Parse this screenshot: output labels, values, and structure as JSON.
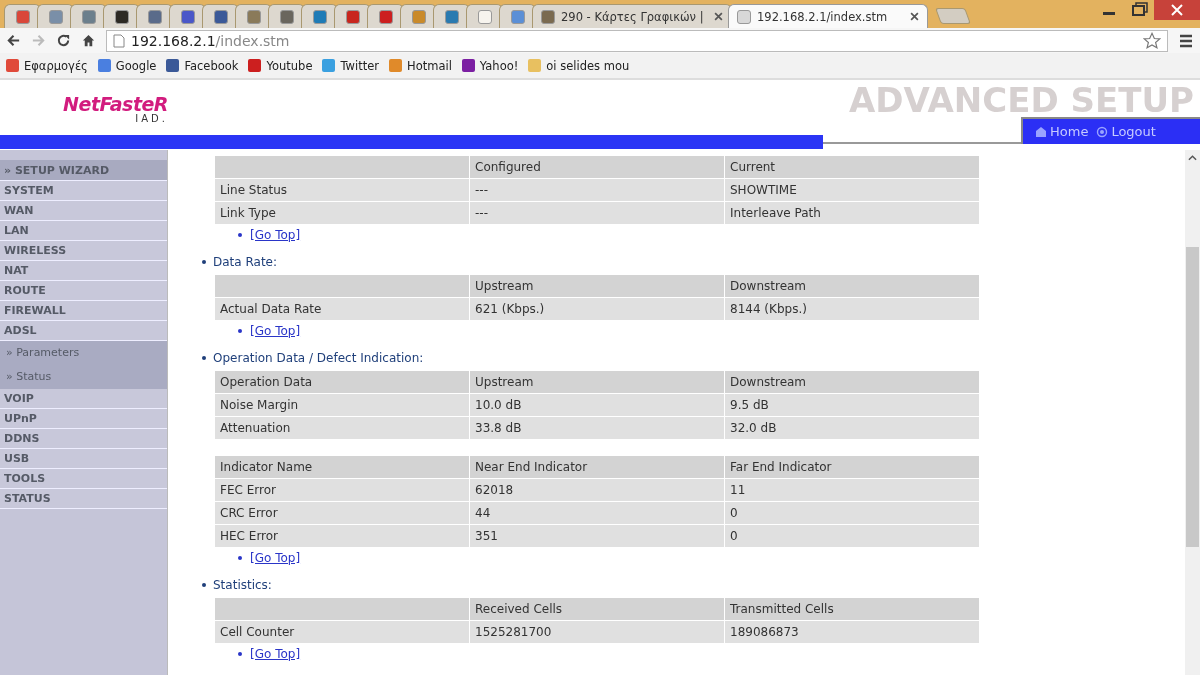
{
  "browser": {
    "tabs": [
      {
        "kind": "favicon",
        "color": "#d9473a",
        "selected": false
      },
      {
        "kind": "favicon",
        "color": "#7a8fa8",
        "selected": false
      },
      {
        "kind": "favicon",
        "color": "#6c7f8c",
        "selected": false
      },
      {
        "kind": "favicon",
        "color": "#2d2a24",
        "selected": false
      },
      {
        "kind": "favicon",
        "color": "#5a6b8a",
        "selected": false
      },
      {
        "kind": "favicon",
        "color": "#4a57c8",
        "selected": false
      },
      {
        "kind": "favicon",
        "color": "#3b5998",
        "selected": false
      },
      {
        "kind": "favicon",
        "color": "#8a7a5a",
        "selected": false
      },
      {
        "kind": "favicon",
        "color": "#6a665e",
        "selected": false
      },
      {
        "kind": "favicon",
        "color": "#1f7bb6",
        "selected": false
      },
      {
        "kind": "favicon",
        "color": "#c8261e",
        "selected": false
      },
      {
        "kind": "favicon",
        "color": "#cc1f1f",
        "selected": false
      },
      {
        "kind": "favicon",
        "color": "#c98a2a",
        "selected": false
      },
      {
        "kind": "favicon",
        "color": "#2a7ab0",
        "selected": false
      },
      {
        "kind": "favicon",
        "color": "#f7f4ee",
        "selected": false
      },
      {
        "kind": "favicon",
        "color": "#5b8fd6",
        "selected": false
      },
      {
        "kind": "titled",
        "title": "290 - Κάρτες Γραφικών |",
        "color": "#7a6a50",
        "selected": false
      },
      {
        "kind": "titled",
        "title": "192.168.2.1/index.stm",
        "color": "#d8d8d8",
        "selected": true
      }
    ],
    "address": {
      "host": "192.168.2.1",
      "path": "/index.stm"
    },
    "bookmarks": [
      {
        "label": "Εφαρμογές",
        "color": "#e04a3a"
      },
      {
        "label": "Google",
        "color": "#4a7fe0"
      },
      {
        "label": "Facebook",
        "color": "#3b5998"
      },
      {
        "label": "Youtube",
        "color": "#cc1f1f"
      },
      {
        "label": "Twitter",
        "color": "#3aa0e0"
      },
      {
        "label": "Hotmail",
        "color": "#e08a2a"
      },
      {
        "label": "Yahoo!",
        "color": "#7b1fa2"
      },
      {
        "label": "oi selides mou",
        "color": "#e8c060"
      }
    ]
  },
  "header": {
    "logo": "NetFasteR",
    "logo_sub": "IAD.",
    "banner": "ADVANCED SETUP",
    "links": [
      "Home",
      "Logout"
    ]
  },
  "sidebar": {
    "items": [
      {
        "label": "» SETUP WIZARD",
        "kind": "wizard"
      },
      {
        "label": "SYSTEM",
        "kind": "main"
      },
      {
        "label": "WAN",
        "kind": "main"
      },
      {
        "label": "LAN",
        "kind": "main"
      },
      {
        "label": "WIRELESS",
        "kind": "main"
      },
      {
        "label": "NAT",
        "kind": "main"
      },
      {
        "label": "ROUTE",
        "kind": "main"
      },
      {
        "label": "FIREWALL",
        "kind": "main"
      },
      {
        "label": "ADSL",
        "kind": "main"
      },
      {
        "label": "» Parameters",
        "kind": "sub"
      },
      {
        "label": "» Status",
        "kind": "sub"
      },
      {
        "label": "VOIP",
        "kind": "main"
      },
      {
        "label": "UPnP",
        "kind": "main"
      },
      {
        "label": "DDNS",
        "kind": "main"
      },
      {
        "label": "USB",
        "kind": "main"
      },
      {
        "label": "TOOLS",
        "kind": "main"
      },
      {
        "label": "STATUS",
        "kind": "main"
      }
    ]
  },
  "sections": [
    {
      "tables": [
        {
          "rows": [
            [
              "",
              "Configured",
              "Current"
            ],
            [
              "Line Status",
              "---",
              "SHOWTIME"
            ],
            [
              "Link Type",
              "---",
              "Interleave Path"
            ]
          ]
        }
      ],
      "link": "[Go Top]"
    },
    {
      "title": "Data Rate:",
      "tables": [
        {
          "rows": [
            [
              "",
              "Upstream",
              "Downstream"
            ],
            [
              "Actual Data Rate",
              "621 (Kbps.)",
              "8144 (Kbps.)"
            ]
          ]
        }
      ],
      "link": "[Go Top]"
    },
    {
      "title": "Operation Data / Defect Indication:",
      "tables": [
        {
          "rows": [
            [
              "Operation Data",
              "Upstream",
              "Downstream"
            ],
            [
              "Noise Margin",
              "10.0 dB",
              "9.5 dB"
            ],
            [
              "Attenuation",
              "33.8 dB",
              "32.0 dB"
            ]
          ]
        },
        {
          "rows": [
            [
              "Indicator Name",
              "Near End Indicator",
              "Far End Indicator"
            ],
            [
              "FEC Error",
              "62018",
              "11"
            ],
            [
              "CRC Error",
              "44",
              "0"
            ],
            [
              "HEC Error",
              "351",
              "0"
            ]
          ]
        }
      ],
      "link": "[Go Top]"
    },
    {
      "title": "Statistics:",
      "tables": [
        {
          "rows": [
            [
              "",
              "Received Cells",
              "Transmitted Cells"
            ],
            [
              "Cell Counter",
              "1525281700",
              "189086873"
            ]
          ]
        }
      ],
      "link": "[Go Top]"
    }
  ]
}
